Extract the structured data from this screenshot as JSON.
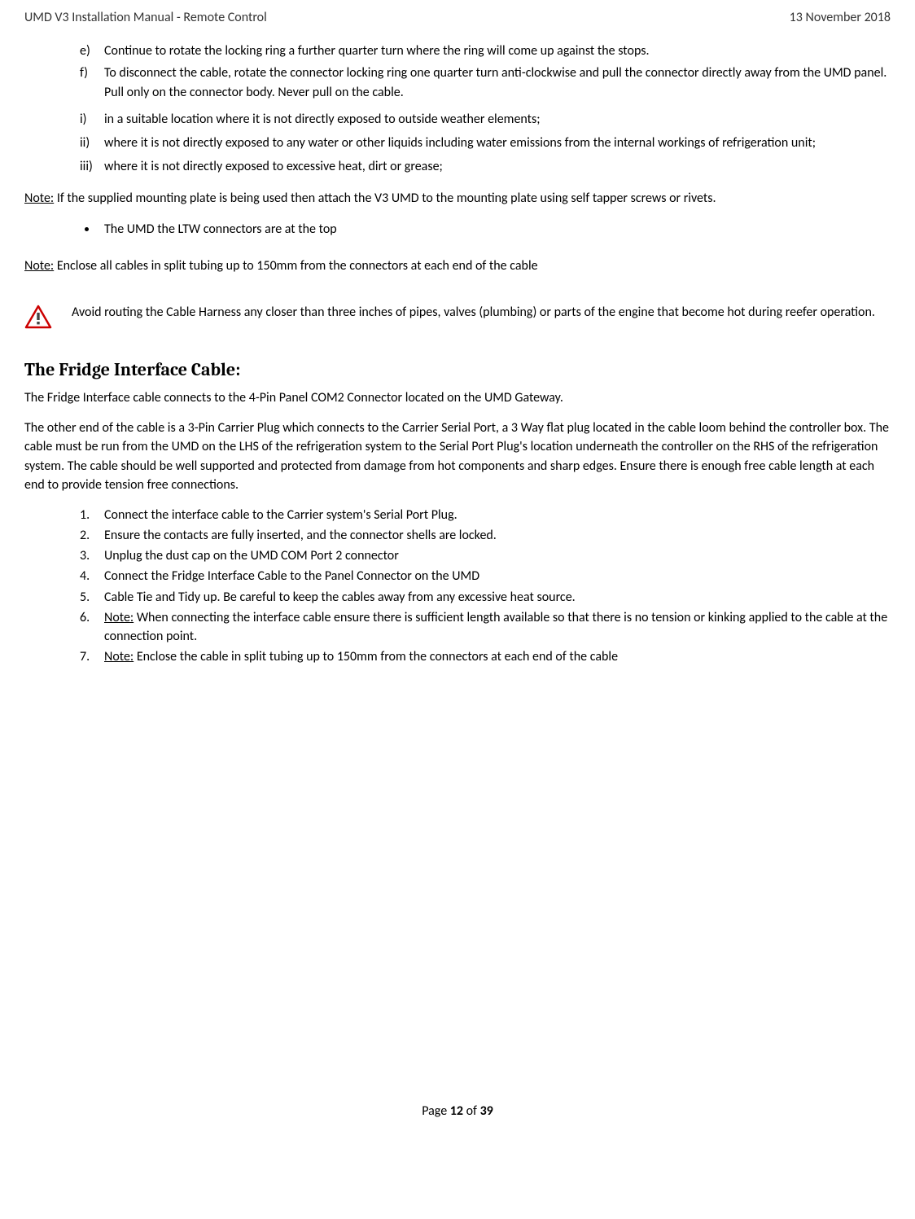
{
  "header": {
    "left": "UMD V3 Installation Manual - Remote Control",
    "right": "13 November 2018"
  },
  "alpha_items": [
    {
      "marker": "e)",
      "text": "Continue to rotate the locking ring a further quarter turn where the ring will come up against the stops."
    },
    {
      "marker": "f)",
      "text": "To disconnect the cable, rotate the connector locking ring one quarter turn anti-clockwise and pull the connector directly away from the UMD panel. Pull only on the connector body. Never pull on the cable."
    }
  ],
  "roman_items": [
    {
      "marker": "i)",
      "text": "in a suitable location where it is not directly exposed to outside weather elements;"
    },
    {
      "marker": "ii)",
      "text": "where it is not directly exposed to any water or other liquids including water emissions from the internal workings of refrigeration unit;"
    },
    {
      "marker": "iii)",
      "text": "where it is not directly exposed to excessive heat, dirt or grease;"
    }
  ],
  "note1_label": "Note:",
  "note1_text": " If the supplied mounting plate is being used then attach the V3 UMD to the mounting plate using self tapper screws or rivets.",
  "bullet_items": [
    "The UMD the LTW connectors are at the top"
  ],
  "note2_label": "Note:",
  "note2_text": " Enclose all cables in split tubing up to 150mm from the connectors at each end of the cable",
  "warning_text": "Avoid routing the Cable Harness any closer than three inches of pipes, valves (plumbing) or parts of the engine that become hot during reefer operation.",
  "section_heading": "The Fridge Interface Cable:",
  "para1": "The Fridge Interface cable connects to the 4-Pin Panel COM2 Connector located on the UMD Gateway.",
  "para2": "The other end of the cable is a 3-Pin Carrier Plug which connects to the Carrier Serial Port, a 3 Way flat plug located in the cable loom behind the controller box. The cable must be run from the UMD on the LHS of the refrigeration system to the Serial Port Plug's location underneath the controller on the RHS of the refrigeration system. The cable should be well supported and protected from damage from hot components and sharp edges. Ensure there is enough free cable length at each end to provide tension free connections.",
  "numbered_items": [
    {
      "marker": "1.",
      "note": "",
      "text": "Connect the interface cable to the Carrier system's Serial Port Plug."
    },
    {
      "marker": "2.",
      "note": "",
      "text": "Ensure the contacts are fully inserted, and the connector shells are locked."
    },
    {
      "marker": "3.",
      "note": "",
      "text": "Unplug the dust cap on the UMD COM Port 2 connector"
    },
    {
      "marker": "4.",
      "note": "",
      "text": "Connect the Fridge Interface Cable to the Panel Connector on the UMD"
    },
    {
      "marker": "5.",
      "note": "",
      "text": "Cable Tie and Tidy up. Be careful to keep the cables away from any excessive heat source."
    },
    {
      "marker": "6.",
      "note": "Note:",
      "text": " When connecting the interface cable ensure there is sufficient length available so that there is no tension or kinking applied to the cable at the connection point."
    },
    {
      "marker": "7.",
      "note": "Note:",
      "text": " Enclose the cable in split tubing up to 150mm from the connectors at each end of the cable"
    }
  ],
  "footer": {
    "prefix": "Page ",
    "current": "12",
    "mid": " of ",
    "total": "39"
  }
}
